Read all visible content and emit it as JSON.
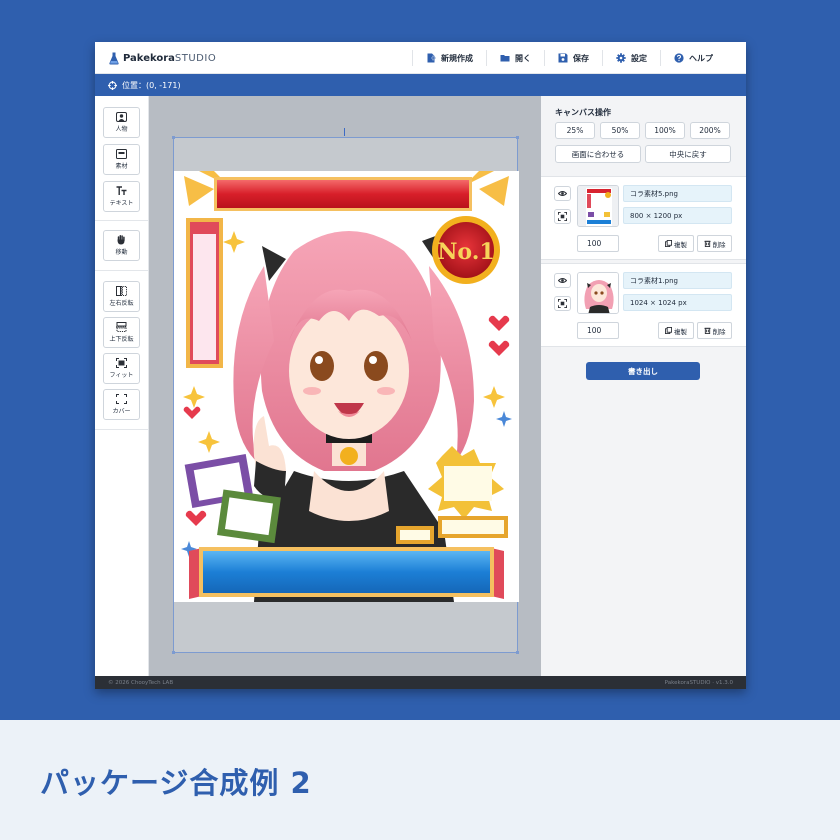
{
  "app": {
    "logo_bold": "Pakekora",
    "logo_light": "STUDIO"
  },
  "menu": [
    {
      "label": "新規作成",
      "icon": "new-file-icon"
    },
    {
      "label": "開く",
      "icon": "folder-icon"
    },
    {
      "label": "保存",
      "icon": "save-icon"
    },
    {
      "label": "設定",
      "icon": "gear-icon"
    },
    {
      "label": "ヘルプ",
      "icon": "help-icon"
    }
  ],
  "status": {
    "position": "位置：(0, -171)"
  },
  "tools": [
    {
      "label": "人物",
      "icon": "person-icon"
    },
    {
      "label": "素材",
      "icon": "material-icon"
    },
    {
      "label": "テキスト",
      "icon": "text-icon"
    },
    {
      "label": "移動",
      "icon": "hand-icon"
    },
    {
      "label": "左右反転",
      "icon": "flip-horizontal-icon"
    },
    {
      "label": "上下反転",
      "icon": "flip-vertical-icon"
    },
    {
      "label": "フィット",
      "icon": "fit-icon"
    },
    {
      "label": "カバー",
      "icon": "cover-icon"
    }
  ],
  "canvas_ops": {
    "title": "キャンバス操作",
    "zoom": [
      "25%",
      "50%",
      "100%",
      "200%"
    ],
    "fit_to_screen": "画面に合わせる",
    "center": "中央に戻す"
  },
  "layers": [
    {
      "name": "コラ素材5.png",
      "size": "800 × 1200 px",
      "opacity": "100",
      "copy": "複製",
      "delete": "削除"
    },
    {
      "name": "コラ素材1.png",
      "size": "1024 × 1024 px",
      "opacity": "100",
      "copy": "複製",
      "delete": "削除"
    }
  ],
  "export_label": "書き出し",
  "footer": {
    "left": "© 2026 ChooyTech LAB",
    "right": "PakekoraSTUDIO · v1.3.0"
  },
  "badge_text": "No.1",
  "caption": "パッケージ合成例 2",
  "colors": {
    "brand_blue": "#2f5fae",
    "footer_dark": "#2b2f36",
    "canvas_gray": "#b7bcc3"
  }
}
